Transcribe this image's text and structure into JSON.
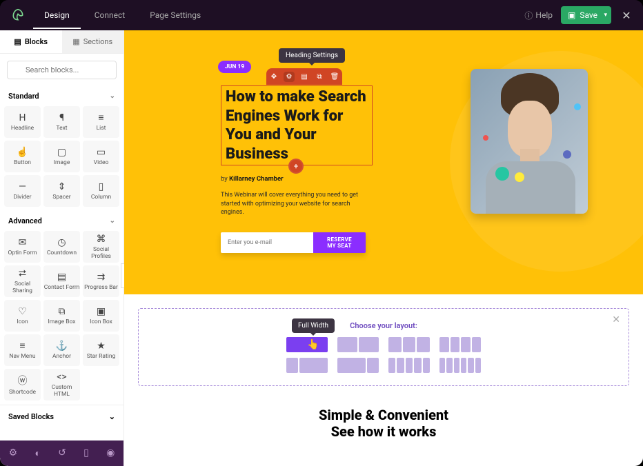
{
  "topnav": {
    "tabs": [
      "Design",
      "Connect",
      "Page Settings"
    ],
    "help": "Help",
    "save": "Save"
  },
  "sidebar": {
    "tabs": {
      "blocks": "Blocks",
      "sections": "Sections"
    },
    "search_placeholder": "Search blocks...",
    "sections_list": [
      {
        "title": "Standard",
        "blocks": [
          {
            "icon": "H",
            "label": "Headline",
            "name": "headline"
          },
          {
            "icon": "¶",
            "label": "Text",
            "name": "text"
          },
          {
            "icon": "≡",
            "label": "List",
            "name": "list"
          },
          {
            "icon": "☝",
            "label": "Button",
            "name": "button"
          },
          {
            "icon": "▢",
            "label": "Image",
            "name": "image"
          },
          {
            "icon": "▭",
            "label": "Video",
            "name": "video"
          },
          {
            "icon": "—",
            "label": "Divider",
            "name": "divider"
          },
          {
            "icon": "⇕",
            "label": "Spacer",
            "name": "spacer"
          },
          {
            "icon": "▯",
            "label": "Column",
            "name": "column"
          }
        ]
      },
      {
        "title": "Advanced",
        "blocks": [
          {
            "icon": "✉",
            "label": "Optin Form",
            "name": "optin-form"
          },
          {
            "icon": "◷",
            "label": "Countdown",
            "name": "countdown"
          },
          {
            "icon": "⌘",
            "label": "Social Profiles",
            "name": "social-profiles"
          },
          {
            "icon": "⮂",
            "label": "Social Sharing",
            "name": "social-sharing"
          },
          {
            "icon": "▤",
            "label": "Contact Form",
            "name": "contact-form"
          },
          {
            "icon": "⇉",
            "label": "Progress Bar",
            "name": "progress-bar"
          },
          {
            "icon": "♡",
            "label": "Icon",
            "name": "icon"
          },
          {
            "icon": "⧉",
            "label": "Image Box",
            "name": "image-box"
          },
          {
            "icon": "▣",
            "label": "Icon Box",
            "name": "icon-box"
          },
          {
            "icon": "≡",
            "label": "Nav Menu",
            "name": "nav-menu"
          },
          {
            "icon": "⚓",
            "label": "Anchor",
            "name": "anchor"
          },
          {
            "icon": "★",
            "label": "Star Rating",
            "name": "star-rating"
          },
          {
            "icon": "ⓦ",
            "label": "Shortcode",
            "name": "shortcode"
          },
          {
            "icon": "<>",
            "label": "Custom HTML",
            "name": "custom-html"
          }
        ]
      }
    ],
    "saved_blocks": "Saved Blocks"
  },
  "hero": {
    "tooltip": "Heading Settings",
    "date_pill": "JUN 19",
    "heading": "How to make Search Engines Work for You and Your Business",
    "byline_prefix": "by ",
    "byline_author": "Killarney Chamber",
    "description": "This Webinar will cover everything you need to get started with optimizing your website for search engines.",
    "email_placeholder": "Enter you e-mail",
    "cta": "RESERVE MY SEAT"
  },
  "layout_picker": {
    "title": "Choose your layout:",
    "tooltip": "Full Width"
  },
  "simple_convenient": {
    "line1": "Simple & Convenient",
    "line2": "See how it works"
  }
}
